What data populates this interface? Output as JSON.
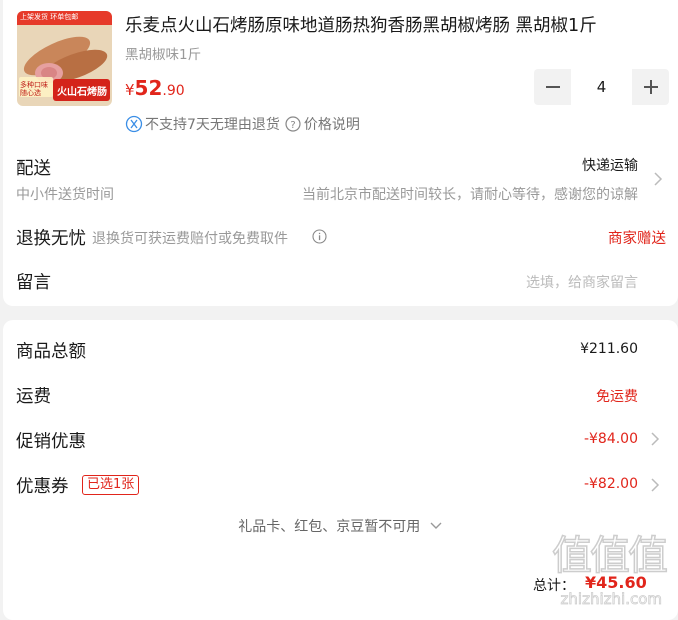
{
  "product": {
    "title": "乐麦点火山石烤肠原味地道肠热狗香肠黑胡椒烤肠 黑胡椒1斤",
    "variant": "黑胡椒味1斤",
    "price_currency": "¥",
    "price_int": "52",
    "price_dec": ".90",
    "quantity": "4",
    "return_notice": "不支持7天无理由退货",
    "price_note": "价格说明",
    "thumb_banner": "上架发货 环单包邮",
    "thumb_caption": "火山石烤肠",
    "thumb_side": "多种口味 随心选"
  },
  "delivery": {
    "label": "配送",
    "method": "快递运输",
    "sub": "中小件送货时间",
    "note": "当前北京市配送时间较长，请耐心等待，感谢您的谅解"
  },
  "return_worry": {
    "label": "退换无忧",
    "desc": "退换货可获运费赔付或免费取件",
    "status": "商家赠送"
  },
  "message": {
    "label": "留言",
    "placeholder": "选填，给商家留言"
  },
  "summary": {
    "goods_total_label": "商品总额",
    "goods_total": "¥211.60",
    "shipping_label": "运费",
    "shipping_value": "免运费",
    "promo_label": "促销优惠",
    "promo_value": "-¥84.00",
    "coupon_label": "优惠券",
    "coupon_badge": "已选1张",
    "coupon_value": "-¥82.00",
    "giftcard_text": "礼品卡、红包、京豆暂不可用",
    "total_label": "总计：",
    "total_value": "¥45.60"
  },
  "watermark": {
    "glyphs": "值值值",
    "domain": "zhizhizhi.com"
  },
  "colors": {
    "accent": "#e1251b",
    "muted": "#999999",
    "page_bg": "#f2f2f2"
  }
}
